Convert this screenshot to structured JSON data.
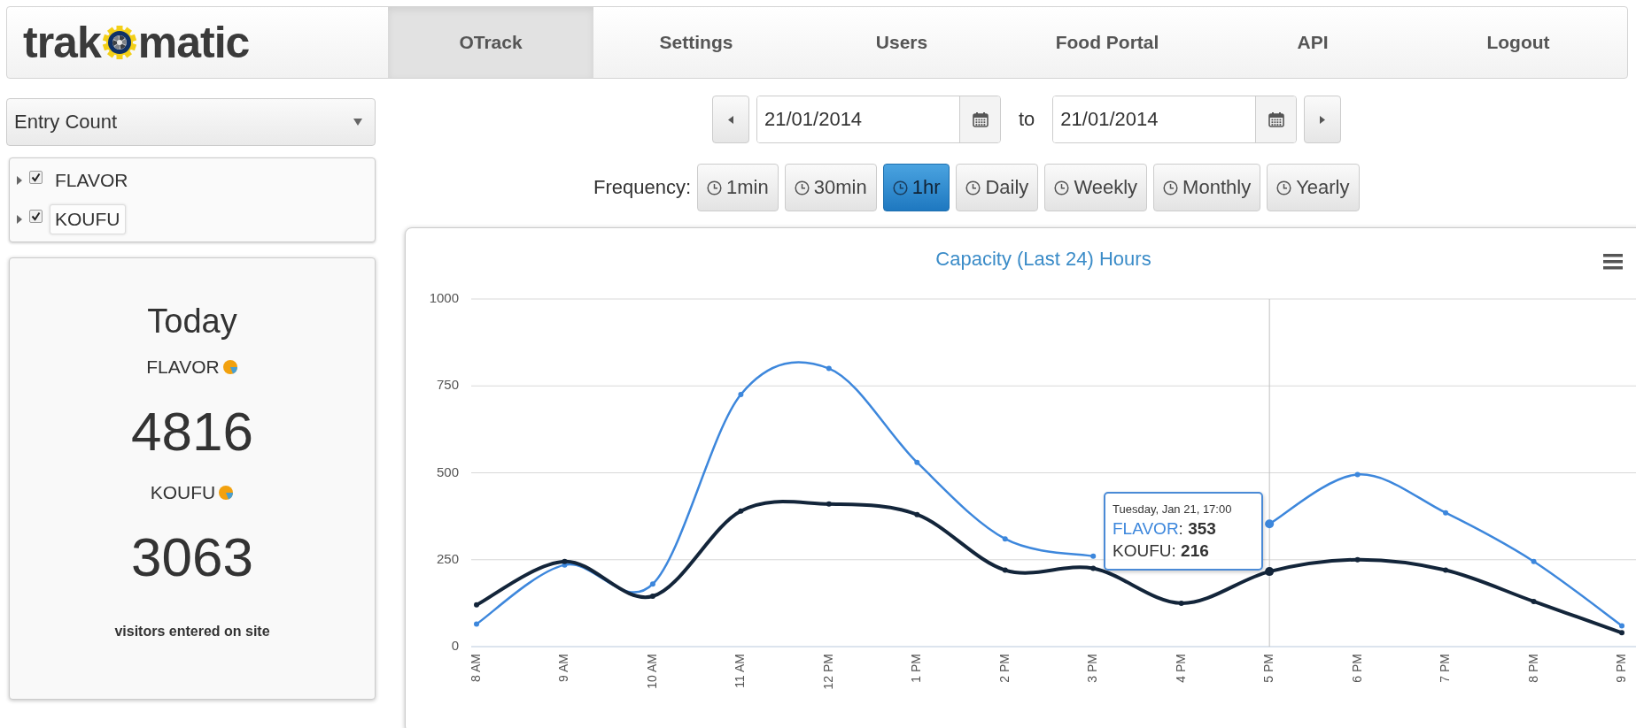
{
  "logo": {
    "left": "trak",
    "right": "matic"
  },
  "nav": [
    {
      "label": "OTrack",
      "selected": true
    },
    {
      "label": "Settings",
      "selected": false
    },
    {
      "label": "Users",
      "selected": false
    },
    {
      "label": "Food Portal",
      "selected": false
    },
    {
      "label": "API",
      "selected": false
    },
    {
      "label": "Logout",
      "selected": false
    }
  ],
  "metric_select": {
    "value": "Entry Count"
  },
  "sites": [
    {
      "label": "FLAVOR",
      "checked": true,
      "selected": false
    },
    {
      "label": "KOUFU",
      "checked": true,
      "selected": true
    }
  ],
  "today": {
    "title": "Today",
    "items": [
      {
        "label": "FLAVOR",
        "value": "4816"
      },
      {
        "label": "KOUFU",
        "value": "3063"
      }
    ],
    "footer": "visitors entered on site"
  },
  "date_range": {
    "from": "21/01/2014",
    "separator": "to",
    "to": "21/01/2014"
  },
  "frequency": {
    "label": "Frequency:",
    "options": [
      {
        "label": "1min",
        "selected": false
      },
      {
        "label": "30min",
        "selected": false
      },
      {
        "label": "1hr",
        "selected": true
      },
      {
        "label": "Daily",
        "selected": false
      },
      {
        "label": "Weekly",
        "selected": false
      },
      {
        "label": "Monthly",
        "selected": false
      },
      {
        "label": "Yearly",
        "selected": false
      }
    ]
  },
  "chart": {
    "chart_data": {
      "type": "line",
      "grid": true,
      "ref_lines": [
        {
          "axis": "x",
          "value": "5 PM"
        }
      ],
      "title": "Capacity (Last 24) Hours",
      "categories": [
        "8 AM",
        "9 AM",
        "10 AM",
        "11 AM",
        "12 PM",
        "1 PM",
        "2 PM",
        "3 PM",
        "4 PM",
        "5 PM",
        "6 PM",
        "7 PM",
        "8 PM",
        "9 PM"
      ],
      "ylim": [
        0,
        1000
      ],
      "yticks": [
        0,
        250,
        500,
        750,
        1000
      ],
      "series": [
        {
          "name": "FLAVOR",
          "color": "#3d87dc",
          "marker": "circle",
          "values": [
            65,
            235,
            180,
            725,
            800,
            530,
            310,
            260,
            null,
            353,
            495,
            385,
            245,
            60
          ]
        },
        {
          "name": "KOUFU",
          "color": "#13253a",
          "marker": "circle",
          "values": [
            120,
            245,
            145,
            390,
            410,
            380,
            220,
            225,
            125,
            216,
            250,
            220,
            130,
            40
          ]
        }
      ]
    },
    "tooltip": {
      "title": "Tuesday, Jan 21, 17:00",
      "separator": ":",
      "values": [
        "353",
        "216"
      ]
    }
  }
}
